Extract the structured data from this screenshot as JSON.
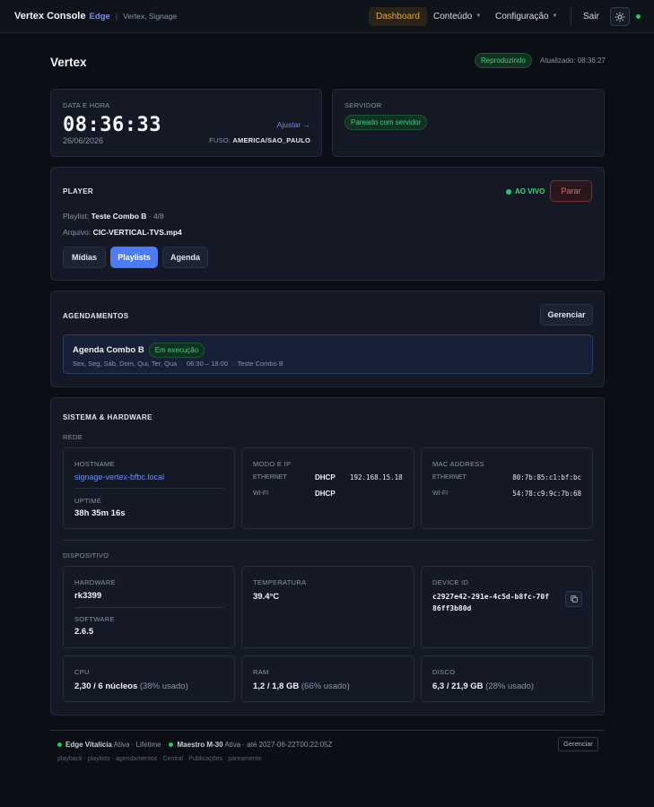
{
  "nav": {
    "brand": "Vertex Console",
    "edge": "Edge",
    "separator": "|",
    "subtitle": "Vertex, Signage",
    "dashboard": "Dashboard",
    "conteudo": "Conteúdo",
    "configuracao": "Configuração",
    "sair": "Sair"
  },
  "header": {
    "title": "Vertex",
    "status": "Reproduzindo",
    "updated": "Atualizado: 08:36:27"
  },
  "datetime": {
    "label": "Data e hora",
    "time": "08:36:33",
    "date": "26/06/2026",
    "adjust": "Ajustar →",
    "tz_label": "FUSO:",
    "tz_value": "AMERICA/SAO_PAULO"
  },
  "server": {
    "label": "Servidor",
    "status": "Pareado com servidor"
  },
  "player": {
    "title": "Player",
    "live": "AO VIVO",
    "stop": "Parar",
    "playlist_label": "Playlist:",
    "playlist_name": "Teste Combo B",
    "playlist_position": "· 4/8",
    "file_label": "Arquivo:",
    "file_name": "CIC-VERTICAL-TVS.mp4",
    "tabs": [
      "Mídias",
      "Playlists",
      "Agenda"
    ]
  },
  "schedules": {
    "title": "Agendamentos",
    "manage": "Gerenciar",
    "item": {
      "name": "Agenda Combo B",
      "status": "Em execução",
      "details": "Sex, Seg, Sáb, Dom, Qui, Ter, Qua  ·  06:30 – 18:00  ·  Teste Combo B"
    }
  },
  "system": {
    "title": "Sistema & Hardware",
    "network_label": "Rede",
    "hostname_label": "Hostname",
    "hostname": "signage-vertex-bfbc.local",
    "uptime_label": "Uptime",
    "uptime": "38h 35m 16s",
    "mode_label": "Modo e IP",
    "ethernet_label": "Ethernet",
    "wifi_label": "Wi-Fi",
    "eth_mode": "DHCP",
    "eth_ip": "192.168.15.18",
    "wifi_mode": "DHCP",
    "mac_label": "MAC Address",
    "mac_eth": "80:7b:85:c1:bf:bc",
    "mac_wifi": "54:78:c9:9c:7b:68",
    "device_label": "Dispositivo",
    "hardware_label": "Hardware",
    "hardware": "rk3399",
    "software_label": "Software",
    "software": "2.6.5",
    "temp_label": "Temperatura",
    "temp": "39.4°C",
    "device_id_label": "Device ID",
    "device_id_line1": "c2927e42-291e-4c5d-b8fc-70f",
    "device_id_line2": "86ff3b80d",
    "cpu_label": "CPU",
    "cpu": "2,30 / 6 núcleos",
    "cpu_usage": "(38% usado)",
    "ram_label": "RAM",
    "ram": "1,2 / 1,8 GB",
    "ram_usage": "(66% usado)",
    "disk_label": "Disco",
    "disk": "6,3 / 21,9 GB",
    "disk_usage": "(28% usado)"
  },
  "footer": {
    "license1_name": "Edge Vitalícia",
    "license1_info": "Ativa · Lifetime",
    "license2_name": "Maestro M-30",
    "license2_info": "Ativa · até 2027-06-22T00:22:05Z",
    "manage": "Gerenciar",
    "features": "playback · playlists · agendamentos · Central · Publicações · pareamento"
  },
  "colors": {
    "accent": "#4d7cf2",
    "warning": "#e3a43a",
    "success": "#2dc46a",
    "danger": "#e26a6a"
  }
}
